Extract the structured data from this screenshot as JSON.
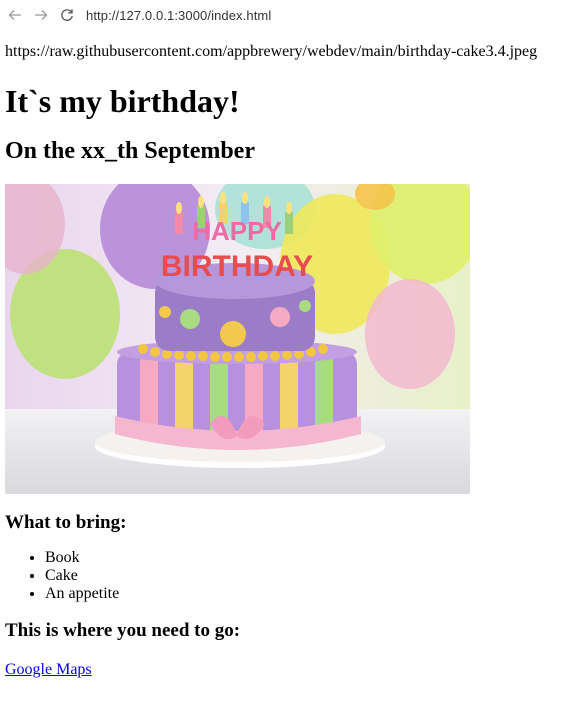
{
  "browser": {
    "url": "http://127.0.0.1:3000/index.html",
    "back_icon": "arrow-left-icon",
    "forward_icon": "arrow-right-icon",
    "reload_icon": "reload-icon"
  },
  "page": {
    "image_url_text": "https://raw.githubusercontent.com/appbrewery/webdev/main/birthday-cake3.4.jpeg",
    "heading": "It`s my birthday!",
    "subheading": "On the xx_th September",
    "bring_heading": "What to bring:",
    "bring_items": [
      "Book",
      "Cake",
      "An appetite"
    ],
    "go_heading": "This is where you need to go:",
    "map_link": "Google Maps",
    "cake_topper_text": "HAPPY BIRTHDAY"
  }
}
